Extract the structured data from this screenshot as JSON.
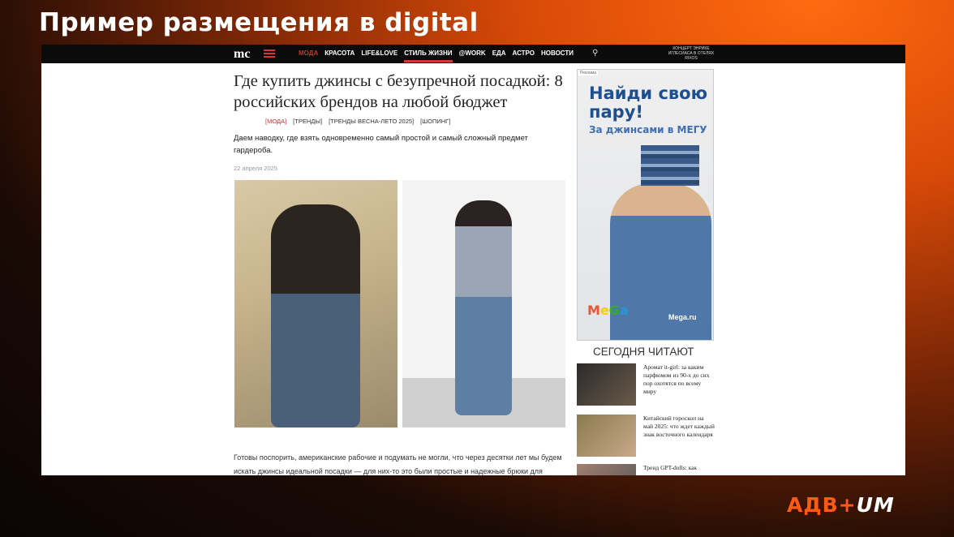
{
  "slide": {
    "title": "Пример размещения в digital",
    "brand_part1": "АДВ+",
    "brand_part2": "UM"
  },
  "nav": {
    "logo": "mc",
    "items": [
      "МОДА",
      "КРАСОТА",
      "LIFE&LOVE",
      "СТИЛЬ ЖИЗНИ",
      "@WORK",
      "ЕДА",
      "АСТРО",
      "НОВОСТИ"
    ],
    "active_index": 0,
    "underlined_index": 3,
    "promo": "КОНЦЕРТ ЭНРИКЕ ИГЛЕСИАСА В ОТЕЛЯХ RIXOS",
    "accent": "#c0392b"
  },
  "article": {
    "title": "Где купить джинсы с безупречной посадкой: 8 российских брендов на любой бюджет",
    "tags": [
      "[МОДА]",
      "[ТРЕНДЫ]",
      "[ТРЕНДЫ ВЕСНА-ЛЕТО 2025]",
      "[ШОПИНГ]"
    ],
    "lead": "Даем наводку, где взять одновременно самый простой и самый сложный предмет гардероба.",
    "date": "22 апреля 2025",
    "body": "Готовы поспорить, американские рабочие и подумать не могли, что через десятки лет мы будем искать джинсы идеальной посадки — для них-то это были простые и надежные брюки для"
  },
  "ad": {
    "label": "Реклама",
    "headline": "Найди свою пару!",
    "sub": "За джинсами в МЕГУ",
    "logo": "MeGa",
    "url": "Mega.ru"
  },
  "sidebar": {
    "title": "СЕГОДНЯ ЧИТАЮТ",
    "items": [
      {
        "title": "Аромат it-girl: за каким парфюмом из 90-х до сих пор охотятся по всему миру"
      },
      {
        "title": "Китайский гороскоп на май 2025: что ждет каждый знак восточного календаря"
      },
      {
        "title": "Тренд GPT-dolls: как"
      }
    ]
  }
}
